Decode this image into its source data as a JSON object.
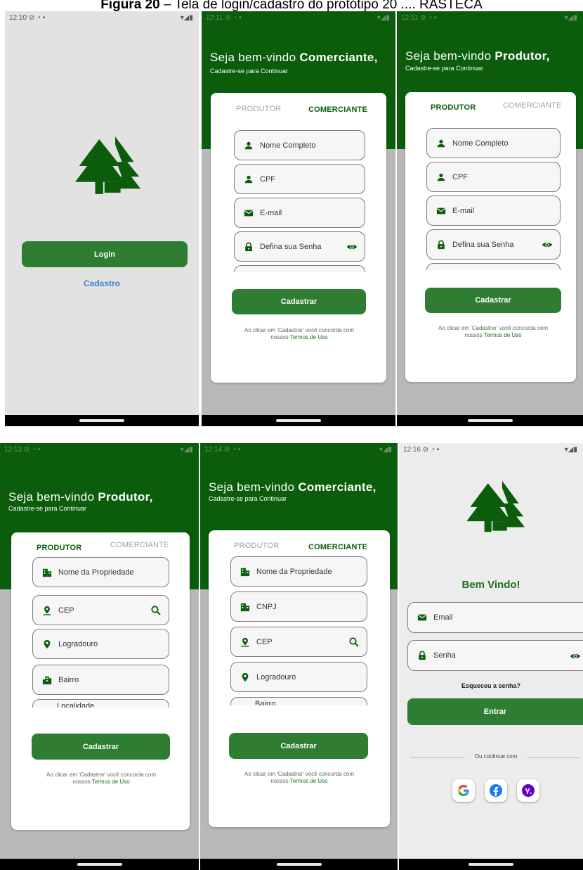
{
  "caption": {
    "bold": "Figura 20",
    "rest": " – Tela de login/cadastro do protótipo 20 .... RASTECA"
  },
  "colors": {
    "primary_green": "#0b5d0b",
    "button_green": "#2e7d32",
    "inactive_tab": "#9aa3b3"
  },
  "screen1": {
    "status_time": "12:10",
    "login_button": "Login",
    "cadastro_link": "Cadastro"
  },
  "screen2": {
    "status_time": "12:11",
    "welcome_prefix": "Seja bem-vindo ",
    "welcome_role": "Comerciante,",
    "subtitle": "Cadastre-se para Continuar",
    "tab_produtor": "PRODUTOR",
    "tab_comerciante": "COMERCIANTE",
    "fields": [
      "Nome Completo",
      "CPF",
      "E-mail",
      "Defina sua Senha"
    ],
    "button": "Cadastrar",
    "terms_text": "Ao clicar em 'Cadastrar' você concorda com",
    "terms_prefix": "nossos ",
    "terms_link": "Termos de Uso"
  },
  "screen3": {
    "status_time": "12:11",
    "welcome_prefix": "Seja bem-vindo ",
    "welcome_role": "Produtor,",
    "subtitle": "Cadastre-se para Continuar",
    "tab_produtor": "PRODUTOR",
    "tab_comerciante": "COMERCIANTE",
    "fields": [
      "Nome Completo",
      "CPF",
      "E-mail",
      "Defina sua Senha"
    ],
    "button": "Cadastrar",
    "terms_text": "Ao clicar em 'Cadastrar' você concorda com",
    "terms_prefix": "nossos ",
    "terms_link": "Termos de Uso"
  },
  "screen4": {
    "status_time": "12:13",
    "welcome_prefix": "Seja bem-vindo ",
    "welcome_role": "Produtor,",
    "subtitle": "Cadastre-se para Continuar",
    "tab_produtor": "PRODUTOR",
    "tab_comerciante": "COMERCIANTE",
    "fields": [
      "Nome da Propriedade",
      "CEP",
      "Logradouro",
      "Bairro"
    ],
    "cutoff_field": "Localidade",
    "button": "Cadastrar",
    "terms_text": "Ao clicar em 'Cadastrar' você concorda com",
    "terms_prefix": "nossos ",
    "terms_link": "Termos de Uso"
  },
  "screen5": {
    "status_time": "12:14",
    "welcome_prefix": "Seja bem-vindo ",
    "welcome_role": "Comerciante,",
    "subtitle": "Cadastre-se para Continuar",
    "tab_produtor": "PRODUTOR",
    "tab_comerciante": "COMERCIANTE",
    "fields": [
      "Nome da Propriedade",
      "CNPJ",
      "CEP",
      "Logradouro"
    ],
    "cutoff_field": "Bairro",
    "button": "Cadastrar",
    "terms_text": "Ao clicar em 'Cadastrar' você concorda com",
    "terms_prefix": "nossos ",
    "terms_link": "Termos de Uso"
  },
  "screen6": {
    "status_time": "12:16",
    "title": "Bem Vindo!",
    "email_field": "Email",
    "password_field": "Senha",
    "forgot": "Esqueceu a senha?",
    "enter_button": "Entrar",
    "divider_text": "Ou continue com"
  }
}
